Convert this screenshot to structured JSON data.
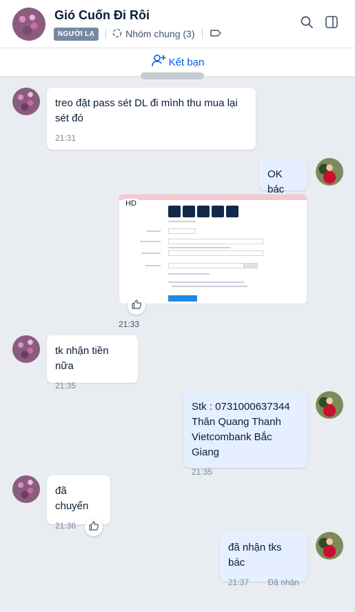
{
  "header": {
    "title": "Gió Cuốn Đi Rôi",
    "stranger_tag": "NGƯỜI LẠ",
    "groups_label": "Nhóm chung (3)"
  },
  "friend_bar": {
    "label": "Kết bạn"
  },
  "messages": [
    {
      "side": "in",
      "text_lines": [
        "treo đặt pass sét DL đi mình thu mua lại",
        "sét đó"
      ],
      "time": "21:31"
    },
    {
      "side": "out",
      "text": "OK bác"
    },
    {
      "side": "out",
      "type": "image",
      "badge": "HD",
      "time": "21:33"
    },
    {
      "side": "in",
      "text": "tk nhận tiền nữa",
      "time": "21:35"
    },
    {
      "side": "out",
      "text_lines": [
        "Stk : 0731000637344",
        "Thân Quang Thanh",
        "Vietcombank Bắc Giang"
      ],
      "time": "21:35"
    },
    {
      "side": "in",
      "text": "đã chuyển",
      "time": "21:36"
    },
    {
      "side": "out",
      "text": "đã nhận tks bác",
      "time": "21:37",
      "status": "Đã nhận"
    }
  ],
  "icons": [
    "group-icon",
    "label-tag-icon",
    "search-icon",
    "sidebar-toggle-icon",
    "add-user-icon",
    "like-icon"
  ],
  "colors": {
    "accent": "#005ae0",
    "out_bubble": "#e5efff",
    "in_bubble": "#ffffff",
    "tag_bg": "#7589a3"
  }
}
